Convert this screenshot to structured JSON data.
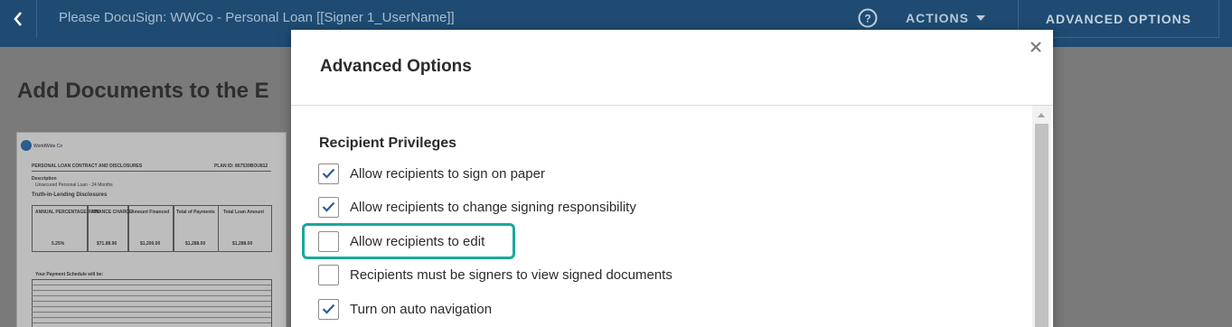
{
  "topbar": {
    "document_title": "Please DocuSign: WWCo - Personal Loan [[Signer 1_UserName]]",
    "actions_label": "ACTIONS",
    "advanced_options_label": "ADVANCED OPTIONS",
    "accent_color": "#1f4b73"
  },
  "page": {
    "heading": "Add Documents to the E"
  },
  "thumbnail": {
    "logo_text": "WorldWide Co",
    "doc_title": "PERSONAL LOAN CONTRACT AND DISCLOSURES",
    "plan_id": "PLAN ID: 867539BOU812",
    "description": "Description",
    "product": "Unsecured Personal Loan - 24 Months",
    "tila_heading": "Truth-in-Lending Disclosures",
    "headers": [
      "ANNUAL PERCENTAGE RATE",
      "FINANCE CHARGE",
      "Amount Financed",
      "Total of Payments",
      "Total Loan Amount"
    ],
    "values": [
      "5.25%",
      "$71.88.96",
      "$1,200.00",
      "$1,288.00",
      "$1,288.00"
    ],
    "schedule_heading": "Your Payment Schedule will be:"
  },
  "modal": {
    "title": "Advanced Options",
    "section_title": "Recipient Privileges",
    "options": [
      {
        "label": "Allow recipients to sign on paper",
        "checked": true
      },
      {
        "label": "Allow recipients to change signing responsibility",
        "checked": true
      },
      {
        "label": "Allow recipients to edit",
        "checked": false
      },
      {
        "label": "Recipients must be signers to view signed documents",
        "checked": false
      },
      {
        "label": "Turn on auto navigation",
        "checked": true
      }
    ],
    "highlight_color": "#1aa89a",
    "check_color": "#2b5e9a"
  }
}
